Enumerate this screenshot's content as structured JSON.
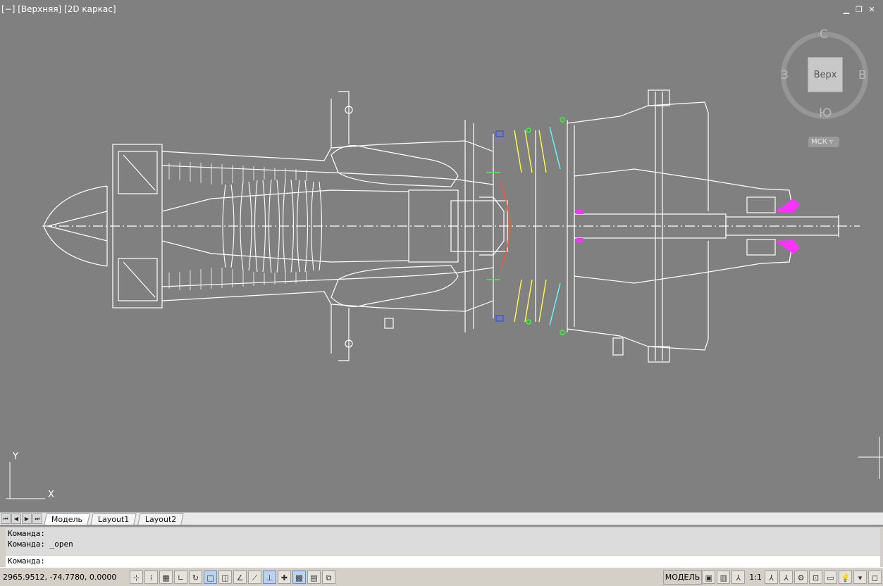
{
  "viewport": {
    "label": "[−] [Верхняя] [2D каркас]",
    "window_controls": [
      "minimize-icon",
      "restore-icon",
      "close-icon"
    ]
  },
  "viewcube": {
    "north": "С",
    "south": "Ю",
    "east": "В",
    "west": "З",
    "face": "Верх",
    "ucs_button": "МСК"
  },
  "ucs_icon": {
    "y": "Y",
    "x": "X"
  },
  "tabs": [
    {
      "label": "Модель",
      "active": true
    },
    {
      "label": "Layout1",
      "active": false
    },
    {
      "label": "Layout2",
      "active": false
    }
  ],
  "command": {
    "history": [
      "Команда:",
      "Команда:  _open"
    ],
    "prompt": "Команда:"
  },
  "status": {
    "coords": "2965.9512, -74.7780, 0.0000",
    "model_label": "МОДЕЛЬ",
    "scale": "1:1"
  },
  "colors": {
    "background": "#808080",
    "drawing": "#ffffff",
    "accent_magenta": "#ff33ff",
    "accent_yellow": "#ffff00",
    "accent_green": "#33ff33",
    "accent_cyan": "#66ffff"
  }
}
